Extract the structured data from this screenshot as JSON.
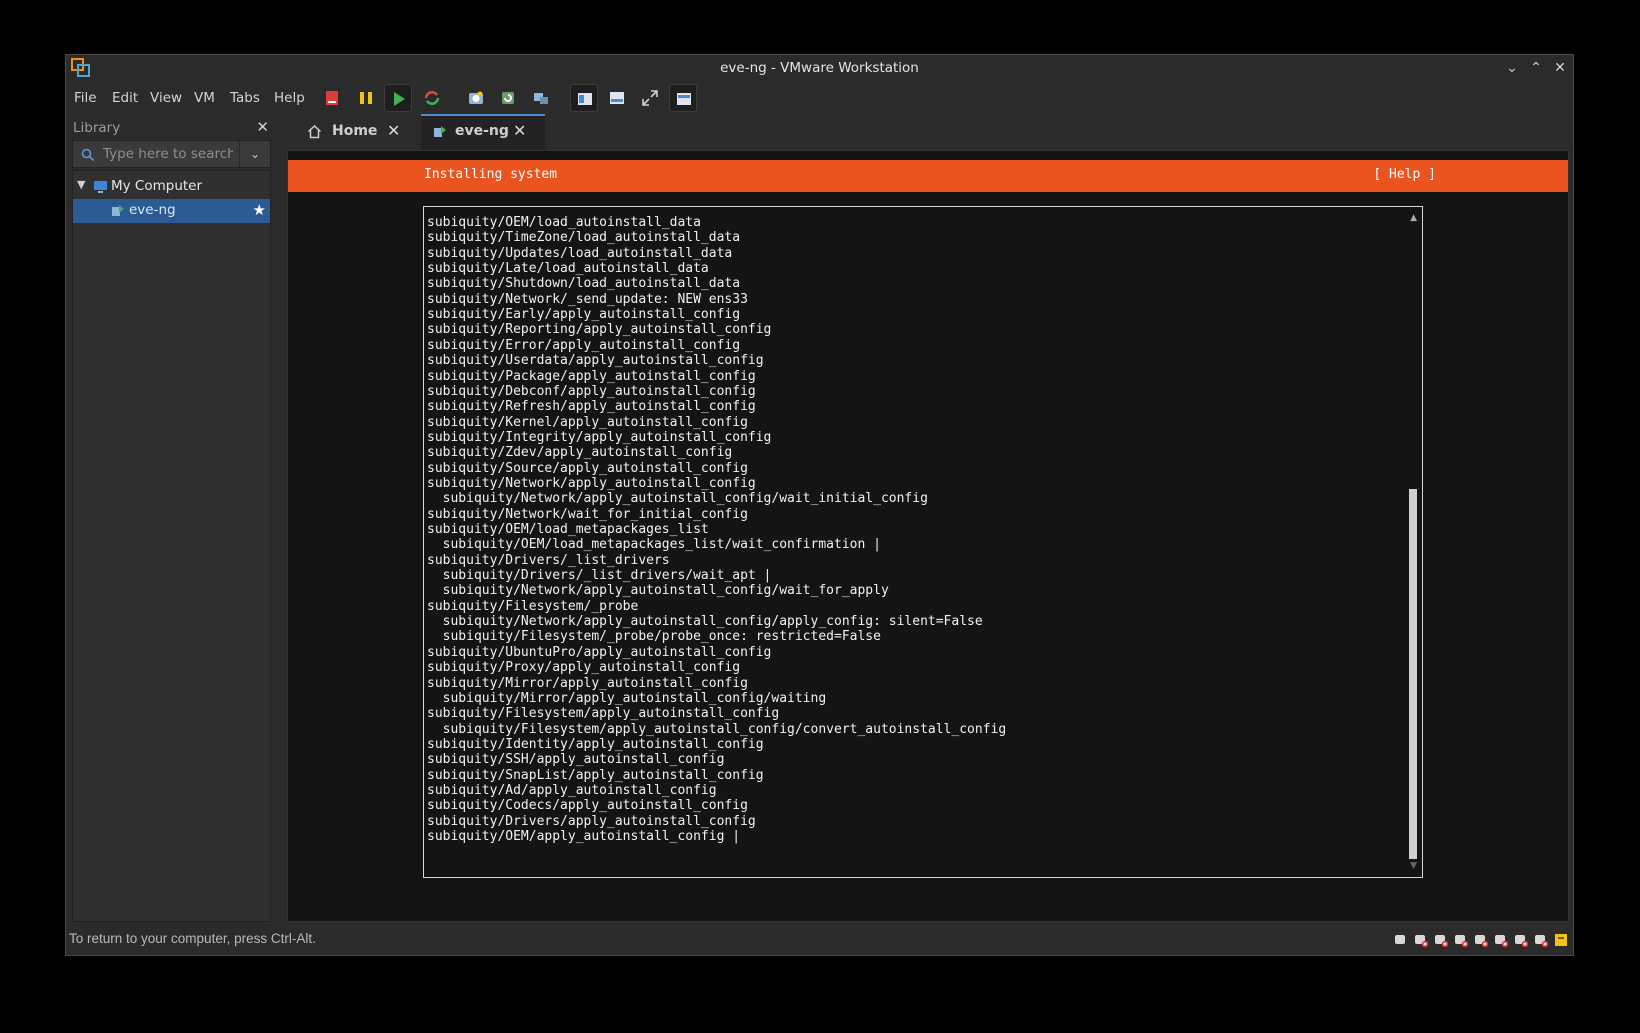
{
  "window": {
    "title": "eve-ng - VMware Workstation"
  },
  "menu": [
    "File",
    "Edit",
    "View",
    "VM",
    "Tabs",
    "Help"
  ],
  "toolbar": {
    "icons": [
      "power-off-icon",
      "suspend-icon",
      "power-on-icon",
      "restart-icon",
      "snapshot-icon",
      "revert-snapshot-icon",
      "snapshot-manager-icon",
      "library-view-icon",
      "thumbnail-bar-icon",
      "full-screen-icon",
      "console-view-icon"
    ],
    "colors": {
      "power_off": "#e03b3b",
      "suspend": "#f2c21b",
      "power_on": "#3fb34f",
      "restart": "#e24a3b"
    }
  },
  "library": {
    "title": "Library",
    "search_placeholder": "Type here to search",
    "tree": {
      "root": "My Computer",
      "items": [
        "eve-ng"
      ]
    }
  },
  "tabs": [
    {
      "label": "Home",
      "icon": "home-icon"
    },
    {
      "label": "eve-ng",
      "icon": "vm-icon",
      "active": true
    }
  ],
  "installer": {
    "title": "Installing system",
    "help": "[ Help ]",
    "accent": "#e95420",
    "log": [
      "subiquity/OEM/load_autoinstall_data",
      "subiquity/TimeZone/load_autoinstall_data",
      "subiquity/Updates/load_autoinstall_data",
      "subiquity/Late/load_autoinstall_data",
      "subiquity/Shutdown/load_autoinstall_data",
      "subiquity/Network/_send_update: NEW ens33",
      "subiquity/Early/apply_autoinstall_config",
      "subiquity/Reporting/apply_autoinstall_config",
      "subiquity/Error/apply_autoinstall_config",
      "subiquity/Userdata/apply_autoinstall_config",
      "subiquity/Package/apply_autoinstall_config",
      "subiquity/Debconf/apply_autoinstall_config",
      "subiquity/Refresh/apply_autoinstall_config",
      "subiquity/Kernel/apply_autoinstall_config",
      "subiquity/Integrity/apply_autoinstall_config",
      "subiquity/Zdev/apply_autoinstall_config",
      "subiquity/Source/apply_autoinstall_config",
      "subiquity/Network/apply_autoinstall_config",
      "  subiquity/Network/apply_autoinstall_config/wait_initial_config",
      "subiquity/Network/wait_for_initial_config",
      "subiquity/OEM/load_metapackages_list",
      "  subiquity/OEM/load_metapackages_list/wait_confirmation |",
      "subiquity/Drivers/_list_drivers",
      "  subiquity/Drivers/_list_drivers/wait_apt |",
      "  subiquity/Network/apply_autoinstall_config/wait_for_apply",
      "subiquity/Filesystem/_probe",
      "  subiquity/Network/apply_autoinstall_config/apply_config: silent=False",
      "  subiquity/Filesystem/_probe/probe_once: restricted=False",
      "subiquity/UbuntuPro/apply_autoinstall_config",
      "subiquity/Proxy/apply_autoinstall_config",
      "subiquity/Mirror/apply_autoinstall_config",
      "  subiquity/Mirror/apply_autoinstall_config/waiting",
      "subiquity/Filesystem/apply_autoinstall_config",
      "  subiquity/Filesystem/apply_autoinstall_config/convert_autoinstall_config",
      "subiquity/Identity/apply_autoinstall_config",
      "subiquity/SSH/apply_autoinstall_config",
      "subiquity/SnapList/apply_autoinstall_config",
      "subiquity/Ad/apply_autoinstall_config",
      "subiquity/Codecs/apply_autoinstall_config",
      "subiquity/Drivers/apply_autoinstall_config",
      "subiquity/OEM/apply_autoinstall_config |"
    ]
  },
  "status": {
    "text": "To return to your computer, press Ctrl-Alt.",
    "device_icons": [
      "hard-disk-icon",
      "cd-dvd-icon",
      "network-adapter-icon",
      "usb-controller-icon",
      "sound-card-icon",
      "printer-icon",
      "display-icon",
      "usb-device-icon",
      "message-log-icon"
    ]
  }
}
